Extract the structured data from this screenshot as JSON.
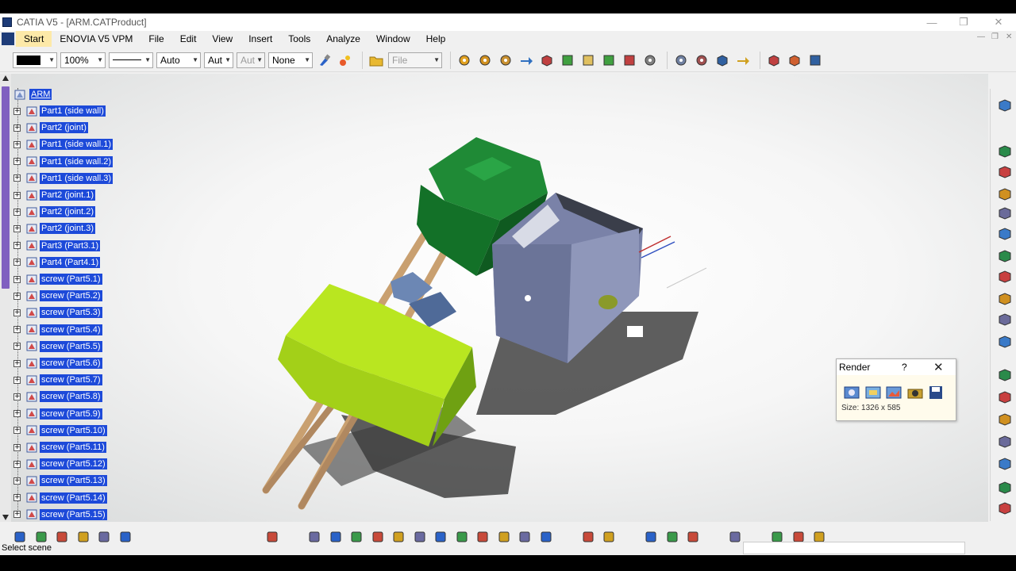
{
  "window": {
    "title": "CATIA V5 - [ARM.CATProduct]",
    "minimize": "—",
    "restore": "❐",
    "close": "✕"
  },
  "menu": [
    "Start",
    "ENOVIA V5 VPM",
    "File",
    "Edit",
    "View",
    "Insert",
    "Tools",
    "Analyze",
    "Window",
    "Help"
  ],
  "toolbar": {
    "color_value": "",
    "zoom_value": "100%",
    "linetype_value": "",
    "thickness_value": "Auto",
    "layer_value": "Aut",
    "layer2_value": "Aut",
    "pattern_value": "None",
    "file_value": "File"
  },
  "tree": {
    "root": "ARM",
    "items": [
      "Part1 (side wall)",
      "Part2 (joint)",
      "Part1 (side wall.1)",
      "Part1 (side wall.2)",
      "Part1 (side wall.3)",
      "Part2 (joint.1)",
      "Part2 (joint.2)",
      "Part2 (joint.3)",
      "Part3 (Part3.1)",
      "Part4 (Part4.1)",
      "screw (Part5.1)",
      "screw (Part5.2)",
      "screw (Part5.3)",
      "screw (Part5.4)",
      "screw (Part5.5)",
      "screw (Part5.6)",
      "screw (Part5.7)",
      "screw (Part5.8)",
      "screw (Part5.9)",
      "screw (Part5.10)",
      "screw (Part5.11)",
      "screw (Part5.12)",
      "screw (Part5.13)",
      "screw (Part5.14)",
      "screw (Part5.15)"
    ]
  },
  "render_panel": {
    "title": "Render",
    "help": "?",
    "close": "✕",
    "size_text": "Size: 1326 x 585"
  },
  "status": {
    "text": "Select scene"
  },
  "colors": {
    "selection": "#1d4ad9",
    "viewport_bg": "#f4f4f4",
    "green_part": "#1f8a36",
    "yellow_part": "#b9e620"
  }
}
